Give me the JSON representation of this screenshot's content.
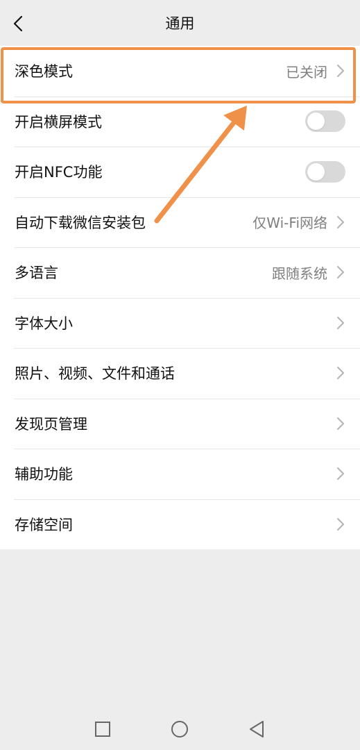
{
  "header": {
    "title": "通用",
    "back_icon": "chevron-left-icon"
  },
  "settings": {
    "items": [
      {
        "label": "深色模式",
        "value": "已关闭",
        "control": "chevron"
      },
      {
        "label": "开启横屏模式",
        "value": "",
        "control": "toggle",
        "toggle_on": false
      },
      {
        "label": "开启NFC功能",
        "value": "",
        "control": "toggle",
        "toggle_on": false
      },
      {
        "label": "自动下载微信安装包",
        "value": "仅Wi-Fi网络",
        "control": "chevron"
      },
      {
        "label": "多语言",
        "value": "跟随系统",
        "control": "chevron"
      },
      {
        "label": "字体大小",
        "value": "",
        "control": "chevron"
      },
      {
        "label": "照片、视频、文件和通话",
        "value": "",
        "control": "chevron"
      },
      {
        "label": "发现页管理",
        "value": "",
        "control": "chevron"
      },
      {
        "label": "辅助功能",
        "value": "",
        "control": "chevron"
      },
      {
        "label": "存储空间",
        "value": "",
        "control": "chevron"
      }
    ]
  },
  "annotation": {
    "color": "#f0914a",
    "highlighted_item": "深色模式"
  },
  "navbar": {
    "buttons": [
      "square-recents-icon",
      "circle-home-icon",
      "triangle-back-icon"
    ]
  },
  "colors": {
    "background": "#ededed",
    "list_background": "#ffffff",
    "toggle_off": "#d9d9d9",
    "secondary_text": "#808080"
  }
}
